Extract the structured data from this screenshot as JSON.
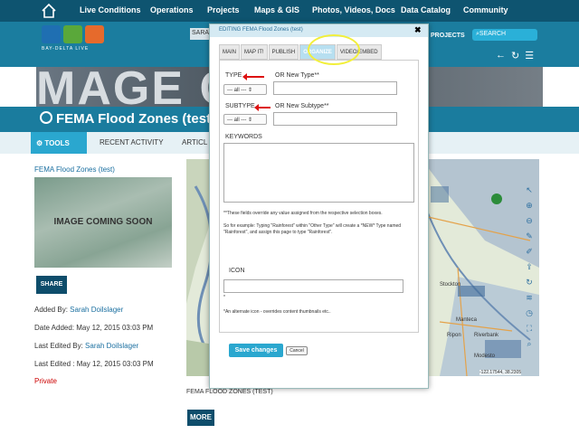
{
  "topnav": {
    "items": [
      "Live Conditions",
      "Operations",
      "Projects",
      "Maps & GIS",
      "Photos, Videos, Docs",
      "Data Catalog",
      "Community"
    ]
  },
  "header": {
    "logo_text": "BAY-DELTA LIVE",
    "user_chip": "SARA",
    "projects_label": "PROJECTS",
    "search_placeholder": "SEARCH"
  },
  "banner": {
    "image_text": "MAGE C     SOOI"
  },
  "page": {
    "title": "FEMA Flood Zones (test)"
  },
  "toolbar": {
    "tools_label": "TOOLS",
    "recent_label": "RECENT ACTIVITY",
    "articles_label": "ARTICL"
  },
  "sidebar": {
    "item_title": "FEMA Flood Zones (test)",
    "thumbnail_text": "IMAGE COMING SOON",
    "share_label": "SHARE",
    "added_by_label": "Added By:",
    "added_by_value": "Sarah Doilslager",
    "date_added": "Date Added: May 12, 2015 03:03 PM",
    "last_edited_by_label": "Last Edited By:",
    "last_edited_by_value": "Sarah Doilslager",
    "last_edited": "Last Edited : May 12, 2015 03:03 PM",
    "privacy": "Private"
  },
  "map": {
    "coords": "-122.17544, 38.2305",
    "caption": "FEMA FLOOD ZONES (TEST)",
    "more_label": "MORE",
    "labels": [
      "Stockton",
      "Manteca",
      "Ripon",
      "Riverbank",
      "Modesto"
    ]
  },
  "dialog": {
    "title": "EDITING FEMA Flood Zones (test)",
    "close": "✖",
    "tabs": [
      "MAIN",
      "MAP IT!",
      "PUBLISH",
      "ORGANIZE",
      "VIDEO/EMBED"
    ],
    "active_tab": "ORGANIZE",
    "type_label": "TYPE",
    "new_type_label": "OR New Type**",
    "type_select": "--- all ---",
    "subtype_label": "SUBTYPE",
    "new_subtype_label": "OR New Subtype**",
    "subtype_select": "--- all ---",
    "keywords_label": "KEYWORDS",
    "override_note": "**These fields override any value assigned from the respective selection boxes.",
    "example_note": "So for example: Typing \"Rainforest\" within \"Other Type\" will create a *NEW* Type named \"Rainforest\", and assign this page to type \"Rainforest\".",
    "icon_label": "ICON",
    "icon_star": "*",
    "icon_note": "*An alternate icon - overrides content thumbnails etc..",
    "save_label": "Save changes",
    "cancel_label": "Cancel"
  },
  "colors": {
    "nav": "#0e5470",
    "accent": "#2aa7cf",
    "highlight": "#f2ef3a",
    "annotation_arrow": "#d11111"
  }
}
